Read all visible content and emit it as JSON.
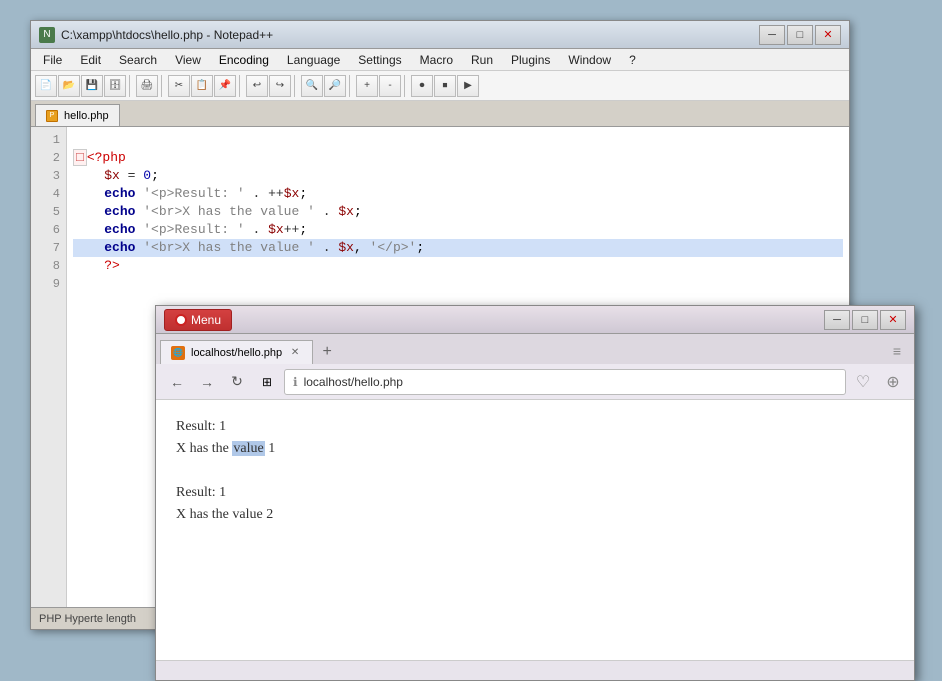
{
  "npp": {
    "titlebar": {
      "text": "C:\\xampp\\htdocs\\hello.php - Notepad++",
      "minimize": "─",
      "maximize": "□",
      "close": "✕"
    },
    "menu": {
      "items": [
        "File",
        "Edit",
        "Search",
        "View",
        "Encoding",
        "Language",
        "Settings",
        "Macro",
        "Run",
        "Plugins",
        "Window",
        "?"
      ]
    },
    "tab": {
      "label": "hello.php"
    },
    "lines": [
      {
        "num": "1",
        "content": "",
        "highlight": false
      },
      {
        "num": "2",
        "content": "<?php",
        "highlight": false
      },
      {
        "num": "3",
        "content": "    $x = 0;",
        "highlight": false
      },
      {
        "num": "4",
        "content": "    echo '<p>Result: ' . ++$x;",
        "highlight": false
      },
      {
        "num": "5",
        "content": "    echo '<br>X has the value ' . $x;",
        "highlight": false
      },
      {
        "num": "6",
        "content": "    echo '<p>Result: ' . $x++;",
        "highlight": false
      },
      {
        "num": "7",
        "content": "    echo '<br>X has the value ' . $x, '</p>';",
        "highlight": true
      },
      {
        "num": "8",
        "content": "    ?>",
        "highlight": false
      },
      {
        "num": "9",
        "content": "",
        "highlight": false
      }
    ],
    "statusbar": "PHP  Hyperte  length"
  },
  "opera": {
    "titlebar": {
      "menu_label": "Menu",
      "minimize": "─",
      "maximize": "□",
      "close": "✕"
    },
    "tab": {
      "label": "localhost/hello.php",
      "close": "✕"
    },
    "address": "localhost/hello.php",
    "content": {
      "lines": [
        "Result: 1",
        "X has the value 1",
        "",
        "Result: 1",
        "X has the value 2"
      ],
      "highlighted_word": "value"
    }
  }
}
